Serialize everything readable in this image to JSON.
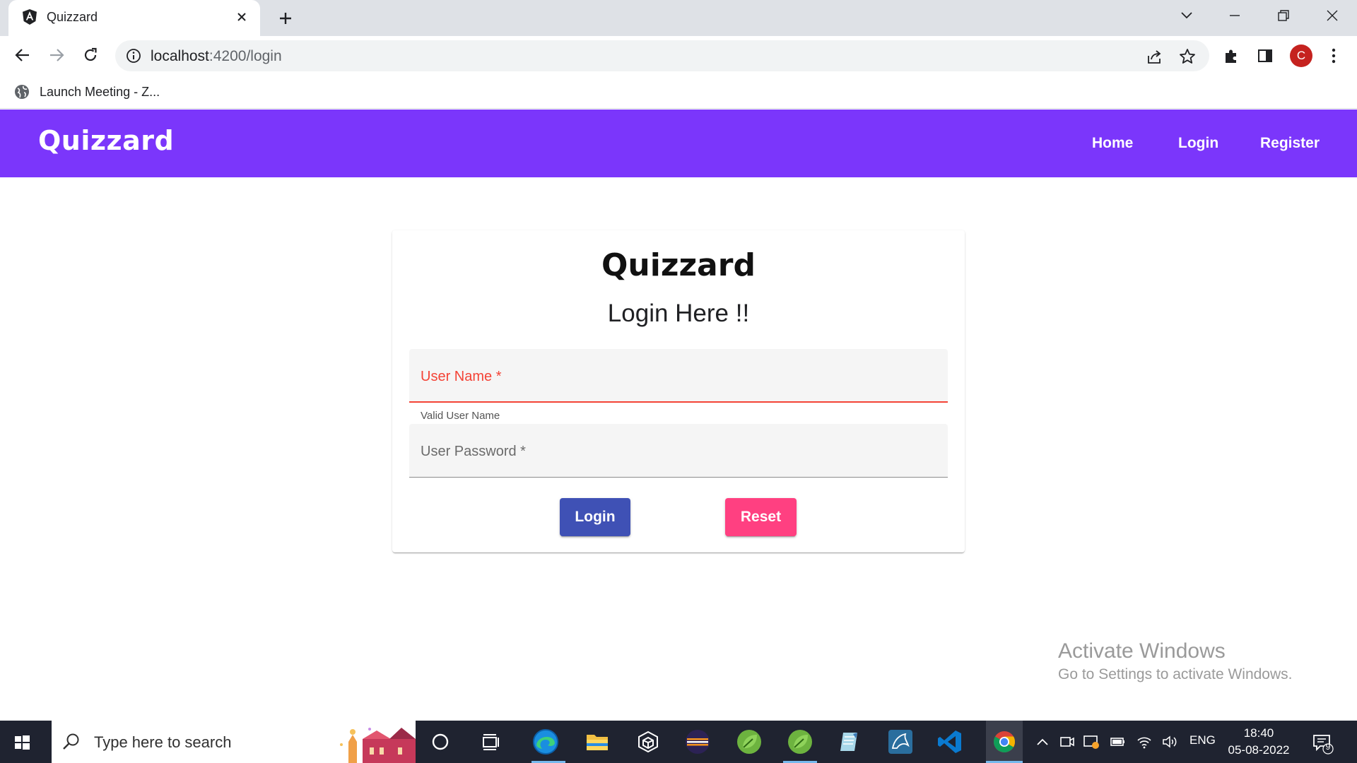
{
  "browser": {
    "tab_title": "Quizzard",
    "url_host": "localhost",
    "url_rest": ":4200/login",
    "profile_initial": "C",
    "bookmark_label": "Launch Meeting - Z..."
  },
  "app": {
    "brand": "Quizzard",
    "nav": {
      "home": "Home",
      "login": "Login",
      "register": "Register"
    },
    "theme_color": "#7b36fb"
  },
  "login_card": {
    "brand": "Quizzard",
    "heading": "Login Here !!",
    "username_label": "User Name *",
    "username_hint": "Valid User Name",
    "password_label": "User Password *",
    "login_button": "Login",
    "reset_button": "Reset",
    "login_color": "#3f51b5",
    "reset_color": "#ff4081"
  },
  "watermark": {
    "line1": "Activate Windows",
    "line2": "Go to Settings to activate Windows."
  },
  "taskbar": {
    "search_placeholder": "Type here to search",
    "language": "ENG",
    "time": "18:40",
    "date": "05-08-2022",
    "notification_count": "9",
    "icons": [
      "cortana-icon",
      "task-view-icon",
      "edge-icon",
      "file-explorer-icon",
      "dev-tool-icon",
      "eclipse-icon",
      "spring-tools-icon",
      "spring-tools-icon",
      "notepad-icon",
      "mysql-workbench-icon",
      "vscode-icon",
      "chrome-icon"
    ]
  }
}
